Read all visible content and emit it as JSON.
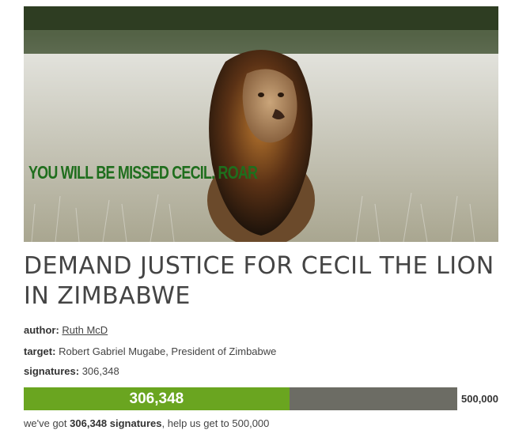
{
  "image": {
    "caption": "YOU WILL BE MISSED CECIL. ROAR",
    "icon": "lion-photo",
    "accent": "#1f6e1d"
  },
  "petition": {
    "title": "DEMAND JUSTICE FOR CECIL THE LION IN ZIMBABWE",
    "author_label": "author:",
    "author_name": "Ruth McD",
    "target_label": "target:",
    "target_value": "Robert Gabriel Mugabe, President of Zimbabwe",
    "signatures_label": "signatures:",
    "signatures_value": "306,348"
  },
  "progress": {
    "current_label": "306,348",
    "goal_label": "500,000",
    "fraction": 0.612696,
    "fill_color": "#6aa520",
    "track_color": "#6c6c64"
  },
  "footer": {
    "prefix": "we've got ",
    "count": "306,348 signatures",
    "suffix": ", help us get to 500,000"
  }
}
